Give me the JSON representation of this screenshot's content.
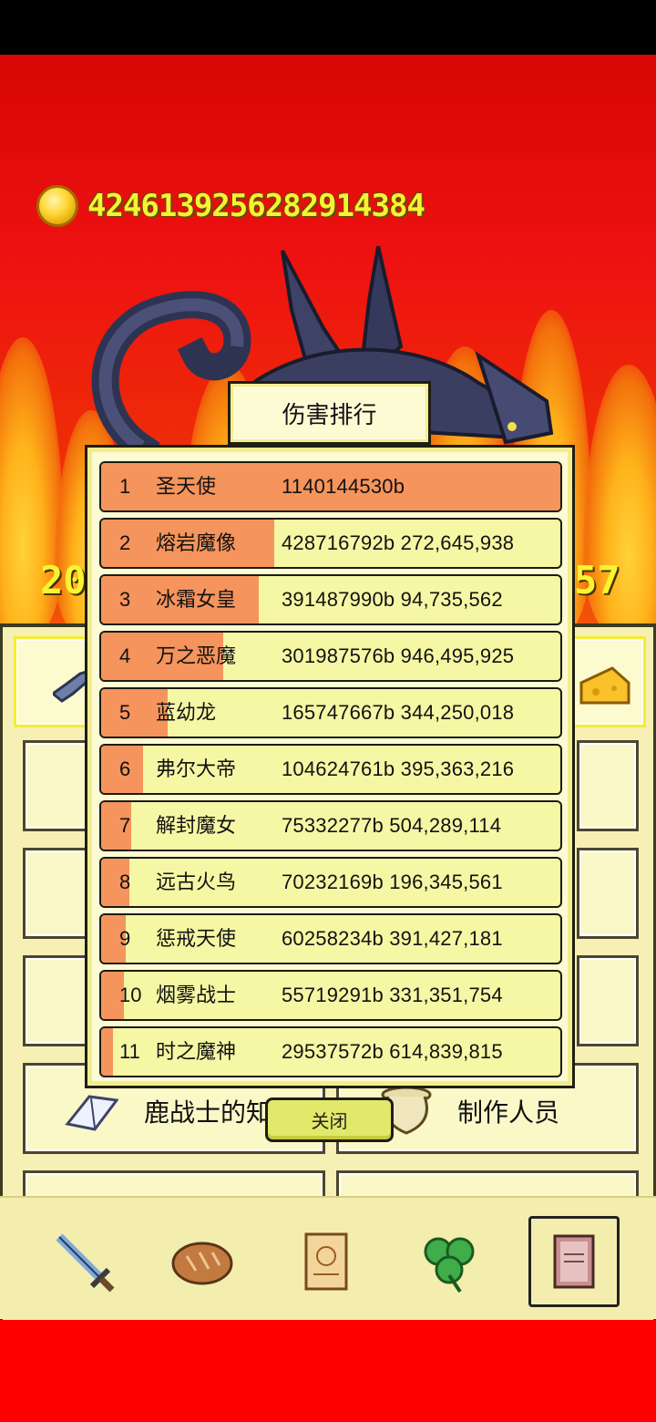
{
  "header": {
    "gold_amount": "4246139256282914384",
    "boss_hp_left": "20",
    "boss_hp_right": "57"
  },
  "menu": {
    "items": [
      {
        "label": "鹿战士的知识",
        "icon": "book-icon"
      },
      {
        "label": "制作人员",
        "icon": "vase-icon"
      }
    ],
    "cheese_icon": "cheese-icon"
  },
  "dialog": {
    "title": "伤害排行",
    "close_label": "关闭",
    "ranking": [
      {
        "rank": "1",
        "name": "圣天使",
        "value": "1140144530b",
        "fill": 1.0
      },
      {
        "rank": "2",
        "name": "熔岩魔像",
        "value": "428716792b 272,645,938",
        "fill": 0.376
      },
      {
        "rank": "3",
        "name": "冰霜女皇",
        "value": "391487990b 94,735,562",
        "fill": 0.343
      },
      {
        "rank": "4",
        "name": "万之恶魔",
        "value": "301987576b 946,495,925",
        "fill": 0.265
      },
      {
        "rank": "5",
        "name": "蓝幼龙",
        "value": "165747667b 344,250,018",
        "fill": 0.145
      },
      {
        "rank": "6",
        "name": "弗尔大帝",
        "value": "104624761b 395,363,216",
        "fill": 0.092
      },
      {
        "rank": "7",
        "name": "解封魔女",
        "value": "75332277b 504,289,114",
        "fill": 0.066
      },
      {
        "rank": "8",
        "name": "远古火鸟",
        "value": "70232169b 196,345,561",
        "fill": 0.062
      },
      {
        "rank": "9",
        "name": "惩戒天使",
        "value": "60258234b 391,427,181",
        "fill": 0.053
      },
      {
        "rank": "10",
        "name": "烟雾战士",
        "value": "55719291b 331,351,754",
        "fill": 0.049
      },
      {
        "rank": "11",
        "name": "时之魔神",
        "value": "29537572b 614,839,815",
        "fill": 0.026
      }
    ]
  },
  "bottom_nav": [
    {
      "icon": "sword-icon",
      "active": false
    },
    {
      "icon": "bread-icon",
      "active": false
    },
    {
      "icon": "scroll-icon",
      "active": false
    },
    {
      "icon": "clover-icon",
      "active": false
    },
    {
      "icon": "journal-icon",
      "active": true
    }
  ],
  "colors": {
    "bar_fill": "#f5945c",
    "row_bg": "#f6f7a4",
    "panel_bg": "#fdfbd4",
    "gold_text": "#f6f235"
  }
}
